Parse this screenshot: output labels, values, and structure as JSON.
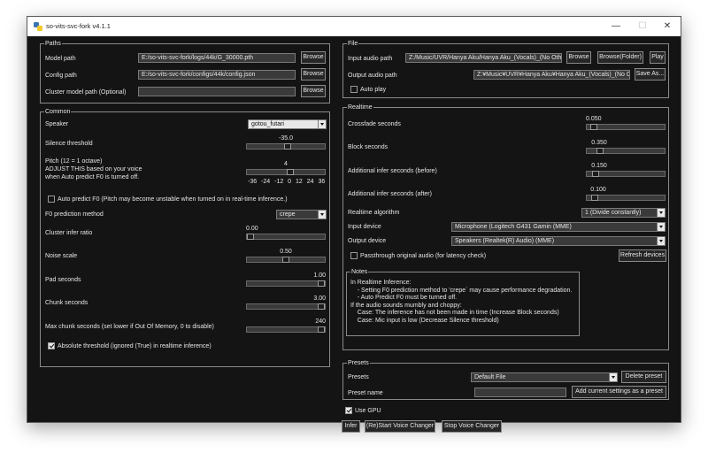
{
  "window": {
    "title": "so-vits-svc-fork v4.1.1",
    "minimize": "—",
    "maximize": "☐",
    "close": "✕"
  },
  "paths": {
    "title": "Paths",
    "model_label": "Model path",
    "model_value": "E:/so-vits-svc-fork/logs/44k/G_30000.pth",
    "config_label": "Config path",
    "config_value": "E:/so-vits-svc-fork/configs/44k/config.json",
    "cluster_label": "Cluster model path (Optional)",
    "cluster_value": "",
    "browse_label": "Browse"
  },
  "common": {
    "title": "Common",
    "speaker_label": "Speaker",
    "speaker_value": "gotou_futari",
    "silence_label": "Silence threshold",
    "silence_value": "-35.0",
    "silence_fraction": 0.53,
    "pitch_label": "Pitch (12 = 1 octave)\nADJUST THIS based on your voice\nwhen Auto predict F0 is turned off.",
    "pitch_value": "4",
    "pitch_fraction": 0.56,
    "pitch_ticks": "-36 -24 -12 0 12 24 36",
    "auto_f0_label": "Auto predict F0 (Pitch may become unstable when turned on in real-time inference.)",
    "auto_f0_checked": false,
    "f0_method_label": "F0 prediction method",
    "f0_method_value": "crepe",
    "cluster_ratio_label": "Cluster infer ratio",
    "cluster_ratio_value": "0.00",
    "cluster_ratio_fraction": 0.0,
    "noise_label": "Noise scale",
    "noise_value": "0.50",
    "noise_fraction": 0.5,
    "pad_label": "Pad seconds",
    "pad_value": "1.00",
    "pad_fraction": 1.0,
    "chunk_label": "Chunk seconds",
    "chunk_value": "3.00",
    "chunk_fraction": 1.0,
    "max_chunk_label": "Max chunk seconds (set lower if Out Of Memory, 0 to disable)",
    "max_chunk_value": "240",
    "max_chunk_fraction": 1.0,
    "abs_threshold_label": "Absolute threshold (ignored (True) in realtime inference)",
    "abs_threshold_checked": true
  },
  "file": {
    "title": "File",
    "input_label": "Input audio path",
    "input_value": "Z:/Music/UVR/Hanya Aku/Hanya Aku_(Vocals)_(No Othe",
    "browse_label": "Browse",
    "browse_folder_label": "Browse(Folder)",
    "play_label": "Play",
    "output_label": "Output audio path",
    "output_value": "Z:¥Music¥UVR¥Hanya Aku¥Hanya Aku_(Vocals)_(No Oth",
    "save_as_label": "Save As...",
    "autoplay_label": "Auto play",
    "autoplay_checked": false
  },
  "realtime": {
    "title": "Realtime",
    "crossfade_label": "Crossfade seconds",
    "crossfade_value": "0.050",
    "crossfade_fraction": 0.05,
    "block_label": "Block seconds",
    "block_value": "0.350",
    "block_fraction": 0.14,
    "before_label": "Additional infer seconds (before)",
    "before_value": "0.150",
    "before_fraction": 0.08,
    "after_label": "Additional infer seconds (after)",
    "after_value": "0.100",
    "after_fraction": 0.06,
    "algorithm_label": "Realtime algorithm",
    "algorithm_value": "1 (Divide constantly)",
    "input_device_label": "Input device",
    "input_device_value": "Microphone (Logitech G431 Gamin (MME)",
    "output_device_label": "Output device",
    "output_device_value": "Speakers (Realtek(R) Audio) (MME)",
    "passthrough_label": "Passthrough original audio (for latency check)",
    "passthrough_checked": false,
    "refresh_label": "Refresh devices"
  },
  "notes": {
    "title": "Notes",
    "text": "In Realtime Inference:\n    - Setting F0 prediction method to 'crepe` may cause performance degradation.\n    - Auto Predict F0 must be turned off.\nIf the audio sounds mumbly and choppy:\n    Case: The inference has not been made in time (Increase Block seconds)\n    Case: Mic input is low (Decrease Silence threshold)"
  },
  "presets": {
    "title": "Presets",
    "presets_label": "Presets",
    "presets_value": "Default File",
    "delete_label": "Delete preset",
    "name_label": "Preset name",
    "name_value": "",
    "add_label": "Add current settings as a preset"
  },
  "bottom": {
    "gpu_label": "Use GPU",
    "gpu_checked": true,
    "infer_label": "Infer",
    "restart_label": "(Re)Start Voice Changer",
    "stop_label": "Stop Voice Changer"
  }
}
